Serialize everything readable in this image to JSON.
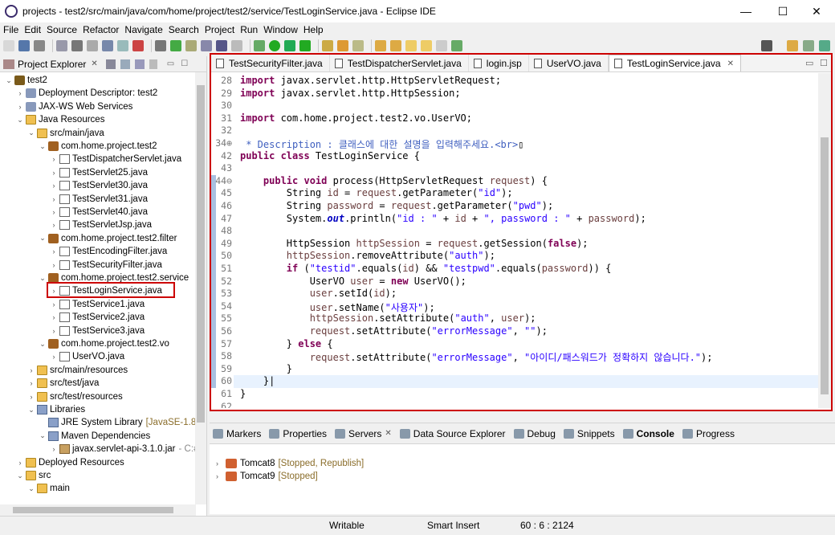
{
  "window": {
    "title": "projects - test2/src/main/java/com/home/project/test2/service/TestLoginService.java - Eclipse IDE",
    "minimize": "—",
    "maximize": "☐",
    "close": "✕"
  },
  "menu": [
    "File",
    "Edit",
    "Source",
    "Refactor",
    "Navigate",
    "Search",
    "Project",
    "Run",
    "Window",
    "Help"
  ],
  "explorer": {
    "title": "Project Explorer",
    "tree": [
      {
        "label": "test2",
        "icon": "project-icon",
        "expanded": true,
        "depth": 0
      },
      {
        "label": "Deployment Descriptor: test2",
        "icon": "deployment-icon",
        "depth": 1
      },
      {
        "label": "JAX-WS Web Services",
        "icon": "webservice-icon",
        "depth": 1
      },
      {
        "label": "Java Resources",
        "icon": "folder-icon",
        "expanded": true,
        "depth": 1
      },
      {
        "label": "src/main/java",
        "icon": "source-folder-icon",
        "expanded": true,
        "depth": 2
      },
      {
        "label": "com.home.project.test2",
        "icon": "package-icon",
        "expanded": true,
        "depth": 3
      },
      {
        "label": "TestDispatcherServlet.java",
        "icon": "java-file-icon",
        "depth": 4
      },
      {
        "label": "TestServlet25.java",
        "icon": "java-file-icon",
        "depth": 4
      },
      {
        "label": "TestServlet30.java",
        "icon": "java-file-icon",
        "depth": 4
      },
      {
        "label": "TestServlet31.java",
        "icon": "java-file-icon",
        "depth": 4
      },
      {
        "label": "TestServlet40.java",
        "icon": "java-file-icon",
        "depth": 4
      },
      {
        "label": "TestServletJsp.java",
        "icon": "java-file-icon",
        "depth": 4
      },
      {
        "label": "com.home.project.test2.filter",
        "icon": "package-icon",
        "expanded": true,
        "depth": 3
      },
      {
        "label": "TestEncodingFilter.java",
        "icon": "java-file-icon",
        "depth": 4
      },
      {
        "label": "TestSecurityFilter.java",
        "icon": "java-file-icon",
        "depth": 4
      },
      {
        "label": "com.home.project.test2.service",
        "icon": "package-icon",
        "expanded": true,
        "depth": 3
      },
      {
        "label": "TestLoginService.java",
        "icon": "java-file-icon",
        "depth": 4,
        "selected": true
      },
      {
        "label": "TestService1.java",
        "icon": "java-file-icon",
        "depth": 4
      },
      {
        "label": "TestService2.java",
        "icon": "java-file-icon",
        "depth": 4
      },
      {
        "label": "TestService3.java",
        "icon": "java-file-icon",
        "depth": 4
      },
      {
        "label": "com.home.project.test2.vo",
        "icon": "package-icon",
        "expanded": true,
        "depth": 3
      },
      {
        "label": "UserVO.java",
        "icon": "java-file-icon",
        "depth": 4
      },
      {
        "label": "src/main/resources",
        "icon": "source-folder-icon",
        "depth": 2
      },
      {
        "label": "src/test/java",
        "icon": "source-folder-icon",
        "depth": 2
      },
      {
        "label": "src/test/resources",
        "icon": "source-folder-icon",
        "depth": 2
      },
      {
        "label": "Libraries",
        "icon": "library-icon",
        "expanded": true,
        "depth": 2
      },
      {
        "label": "JRE System Library",
        "suffix": "[JavaSE-1.8]",
        "icon": "jre-icon",
        "depth": 3
      },
      {
        "label": "Maven Dependencies",
        "icon": "library-icon",
        "expanded": true,
        "depth": 3
      },
      {
        "label": "javax.servlet-api-3.1.0.jar",
        "suffix2": "- C:#",
        "icon": "jar-icon",
        "depth": 4
      },
      {
        "label": "Deployed Resources",
        "icon": "folder-icon",
        "depth": 1
      },
      {
        "label": "src",
        "icon": "folder-icon",
        "expanded": true,
        "depth": 1
      },
      {
        "label": "main",
        "icon": "folder-icon",
        "expanded": true,
        "depth": 2
      }
    ]
  },
  "editor": {
    "tabs": [
      {
        "label": "TestSecurityFilter.java",
        "active": false
      },
      {
        "label": "TestDispatcherServlet.java",
        "active": false
      },
      {
        "label": "login.jsp",
        "active": false
      },
      {
        "label": "UserVO.java",
        "active": false
      },
      {
        "label": "TestLoginService.java",
        "active": true
      }
    ],
    "lines": [
      {
        "n": "28",
        "html": "<span class=\"kw\">import</span> javax.servlet.http.HttpServletRequest;"
      },
      {
        "n": "29",
        "html": "<span class=\"kw\">import</span> javax.servlet.http.HttpSession;"
      },
      {
        "n": "30",
        "html": ""
      },
      {
        "n": "31",
        "html": "<span class=\"kw\">import</span> com.home.project.test2.vo.UserVO;"
      },
      {
        "n": "32",
        "html": ""
      },
      {
        "n": "34⊕",
        "html": "<span class=\"cmt\"> * Description : 클래스에 대한 설명을 입력해주세요.&lt;br&gt;</span>▯"
      },
      {
        "n": "42",
        "html": "<span class=\"kw\">public class</span> TestLoginService {"
      },
      {
        "n": "43",
        "html": ""
      },
      {
        "n": "44⊖",
        "html": "    <span class=\"kw\">public void</span> process(HttpServletRequest <span class=\"var\">request</span>) {"
      },
      {
        "n": "45",
        "html": "        String <span class=\"var\">id</span> = <span class=\"var\">request</span>.getParameter(<span class=\"str\">\"id\"</span>);"
      },
      {
        "n": "46",
        "html": "        String <span class=\"var\">password</span> = <span class=\"var\">request</span>.getParameter(<span class=\"str\">\"pwd\"</span>);"
      },
      {
        "n": "47",
        "html": "        System.<span class=\"fld\">out</span>.println(<span class=\"str\">\"id : \"</span> + <span class=\"var\">id</span> + <span class=\"str\">\", password : \"</span> + <span class=\"var\">password</span>);"
      },
      {
        "n": "48",
        "html": ""
      },
      {
        "n": "49",
        "html": "        HttpSession <span class=\"var\">httpSession</span> = <span class=\"var\">request</span>.getSession(<span class=\"kw\">false</span>);"
      },
      {
        "n": "50",
        "html": "        <span class=\"var\">httpSession</span>.removeAttribute(<span class=\"str\">\"auth\"</span>);"
      },
      {
        "n": "51",
        "html": "        <span class=\"kw\">if</span> (<span class=\"str\">\"testid\"</span>.equals(<span class=\"var\">id</span>) &amp;&amp; <span class=\"str\">\"testpwd\"</span>.equals(<span class=\"var\">password</span>)) {"
      },
      {
        "n": "52",
        "html": "            UserVO <span class=\"var\">user</span> = <span class=\"kw\">new</span> UserVO();"
      },
      {
        "n": "53",
        "html": "            <span class=\"var\">user</span>.setId(<span class=\"var\">id</span>);"
      },
      {
        "n": "54",
        "html": "            <span class=\"var\">user</span>.setName(<span class=\"str\">\"사용자\"</span>);"
      },
      {
        "n": "55",
        "html": "            <span class=\"var\">httpSession</span>.setAttribute(<span class=\"str\">\"auth\"</span>, <span class=\"var\">user</span>);"
      },
      {
        "n": "56",
        "html": "            <span class=\"var\">request</span>.setAttribute(<span class=\"str\">\"errorMessage\"</span>, <span class=\"str\">\"\"</span>);"
      },
      {
        "n": "57",
        "html": "        } <span class=\"kw\">else</span> {"
      },
      {
        "n": "58",
        "html": "            <span class=\"var\">request</span>.setAttribute(<span class=\"str\">\"errorMessage\"</span>, <span class=\"str\">\"아이디/패스워드가 정확하지 않습니다.\"</span>);"
      },
      {
        "n": "59",
        "html": "        }"
      },
      {
        "n": "60",
        "html": "    }|"
      },
      {
        "n": "61",
        "html": "}"
      },
      {
        "n": "62",
        "html": ""
      }
    ]
  },
  "bottom": {
    "tabs": [
      "Markers",
      "Properties",
      "Servers",
      "Data Source Explorer",
      "Debug",
      "Snippets",
      "Console",
      "Progress"
    ],
    "servers": [
      {
        "name": "Tomcat8",
        "state": "[Stopped, Republish]"
      },
      {
        "name": "Tomcat9",
        "state": "[Stopped]"
      }
    ]
  },
  "status": {
    "writable": "Writable",
    "insert": "Smart Insert",
    "position": "60 : 6 : 2124"
  }
}
